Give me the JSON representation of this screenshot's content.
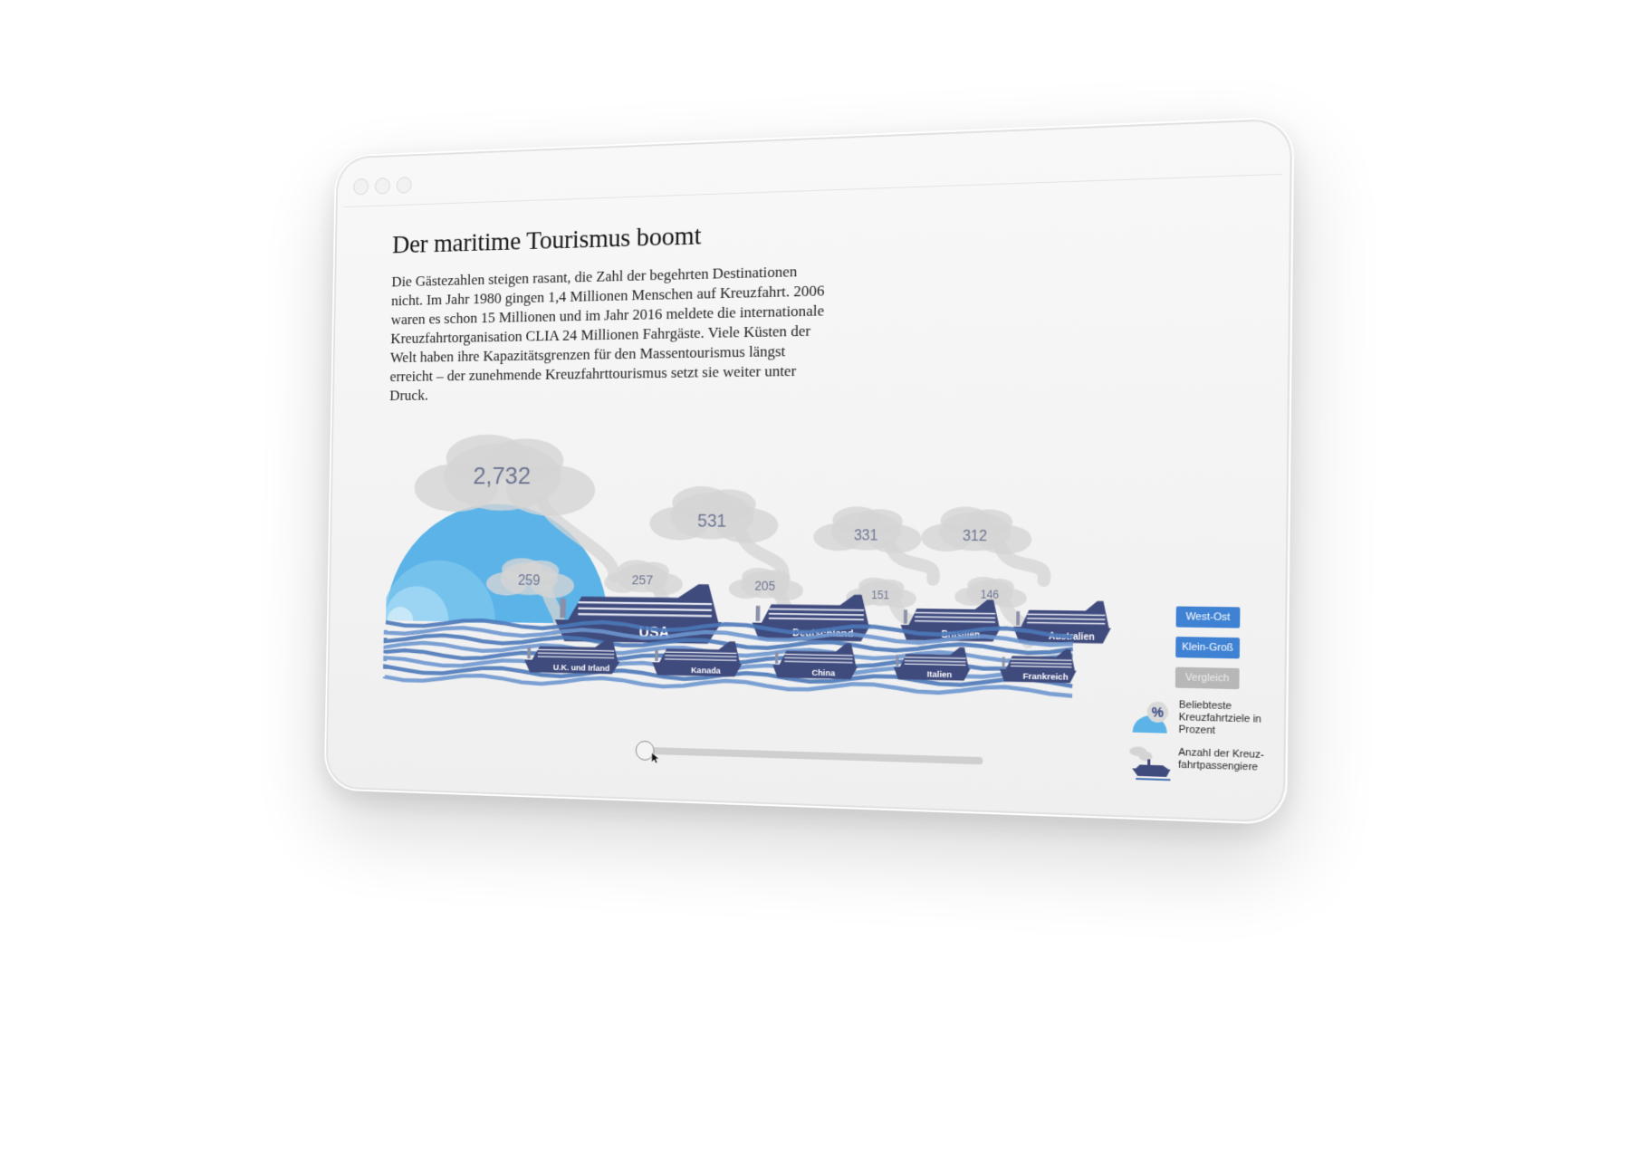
{
  "headline": "Der maritime Tourismus boomt",
  "intro": "Die Gästezahlen steigen rasant, die Zahl der begehrten Destinationen nicht. Im Jahr 1980 gingen 1,4 Millionen Menschen auf Kreuzfahrt. 2006 waren es schon 15 Millionen und im Jahr 2016 meldete die internationale Kreuzfahrtorganisation CLIA 24 Millionen Fahrgäste. Viele Küsten der Welt haben ihre Kapazitätsgrenzen für den Massentourismus längst erreicht – der zunehmende Kreuzfahrttourismus setzt sie weiter unter Druck.",
  "buttons": {
    "west_ost": "West-Ost",
    "klein_gross": "Klein-Groß",
    "vergleich": "Vergleich"
  },
  "legend": {
    "percent_symbol": "%",
    "percent_text": "Beliebteste Kreuzfahrtziele in Prozent",
    "passengers_text": "Anzahl der Kreuz-fahrtpassengiere"
  },
  "colors": {
    "ship_navy": "#3f4a7d",
    "ship_stripe": "#e9ecf5",
    "wave_blue": "#4b78b8",
    "bubble_blue": "#5bb3e8",
    "smoke_grey": "#d4d4d4",
    "value_text": "#6e7693",
    "button_blue": "#3f82d4",
    "button_grey": "#b7b7b7"
  },
  "chart_data": {
    "type": "other",
    "x_unit": "",
    "y_unit": "",
    "bubble_value": 2732,
    "back_row": [
      {
        "name": "USA",
        "value": 2732,
        "value_label": "2,732"
      },
      {
        "name": "Deutschland",
        "value": 531,
        "value_label": "531"
      },
      {
        "name": "Brasilien",
        "value": 331,
        "value_label": "331"
      },
      {
        "name": "Australien",
        "value": 312,
        "value_label": "312"
      }
    ],
    "front_row": [
      {
        "name": "U.K. und Irland",
        "value": 259,
        "value_label": "259"
      },
      {
        "name": "Kanada",
        "value": 257,
        "value_label": "257"
      },
      {
        "name": "China",
        "value": 205,
        "value_label": "205"
      },
      {
        "name": "Italien",
        "value": 151,
        "value_label": "151"
      },
      {
        "name": "Frankreich",
        "value": 146,
        "value_label": "146"
      }
    ]
  }
}
